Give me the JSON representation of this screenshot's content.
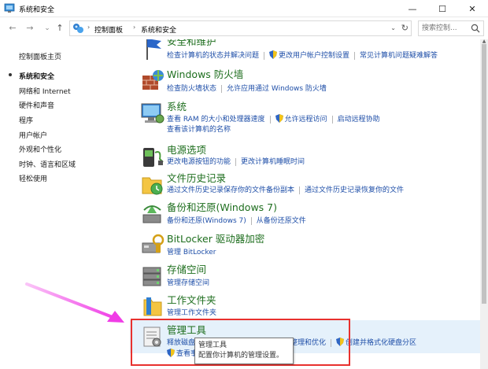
{
  "window": {
    "title": "系统和安全",
    "min": "—",
    "max": "☐",
    "close": "✕"
  },
  "nav": {
    "back": "←",
    "forward": "→",
    "dropdown": "⌄",
    "up": "↑",
    "breadcrumb": [
      "控制面板",
      "系统和安全"
    ],
    "sep": "›",
    "addr_dropdown": "⌄",
    "refresh": "↻",
    "search_placeholder": "搜索控制..."
  },
  "sidebar": {
    "home": "控制面板主页",
    "items": [
      "系统和安全",
      "网络和 Internet",
      "硬件和声音",
      "程序",
      "用户帐户",
      "外观和个性化",
      "时钟、语言和区域",
      "轻松使用"
    ]
  },
  "categories": [
    {
      "title": "安全和维护",
      "rows": [
        [
          "检查计算机的状态并解决问题",
          "更改用户帐户控制设置",
          "常见计算机问题疑难解答"
        ]
      ]
    },
    {
      "title": "Windows 防火墙",
      "rows": [
        [
          "检查防火墙状态",
          "允许应用通过 Windows 防火墙"
        ]
      ]
    },
    {
      "title": "系统",
      "rows": [
        [
          "查看 RAM 的大小和处理器速度",
          "允许远程访问",
          "启动远程协助"
        ],
        [
          "查看该计算机的名称"
        ]
      ]
    },
    {
      "title": "电源选项",
      "rows": [
        [
          "更改电源按钮的功能",
          "更改计算机睡眠时间"
        ]
      ]
    },
    {
      "title": "文件历史记录",
      "rows": [
        [
          "通过文件历史记录保存你的文件备份副本",
          "通过文件历史记录恢复你的文件"
        ]
      ]
    },
    {
      "title": "备份和还原(Windows 7)",
      "rows": [
        [
          "备份和还原(Windows 7)",
          "从备份还原文件"
        ]
      ]
    },
    {
      "title": "BitLocker 驱动器加密",
      "rows": [
        [
          "管理 BitLocker"
        ]
      ]
    },
    {
      "title": "存储空间",
      "rows": [
        [
          "管理存储空间"
        ]
      ]
    },
    {
      "title": "工作文件夹",
      "rows": [
        [
          "管理工作文件夹"
        ]
      ]
    },
    {
      "title": "管理工具",
      "rows": [
        [
          "释放磁盘空间",
          "对你的驱动器进行碎片整理和优化",
          "创建并格式化硬盘分区"
        ],
        [
          "查看事件日志"
        ]
      ]
    }
  ],
  "tooltip": {
    "title": "管理工具",
    "desc": "配置你计算机的管理设置。"
  },
  "colors": {
    "link": "#1f4fa8",
    "title": "#1e6e1e",
    "highlight": "#e5f1fb",
    "annotation_box": "#e8312e",
    "arrow": "#f03ce6"
  }
}
